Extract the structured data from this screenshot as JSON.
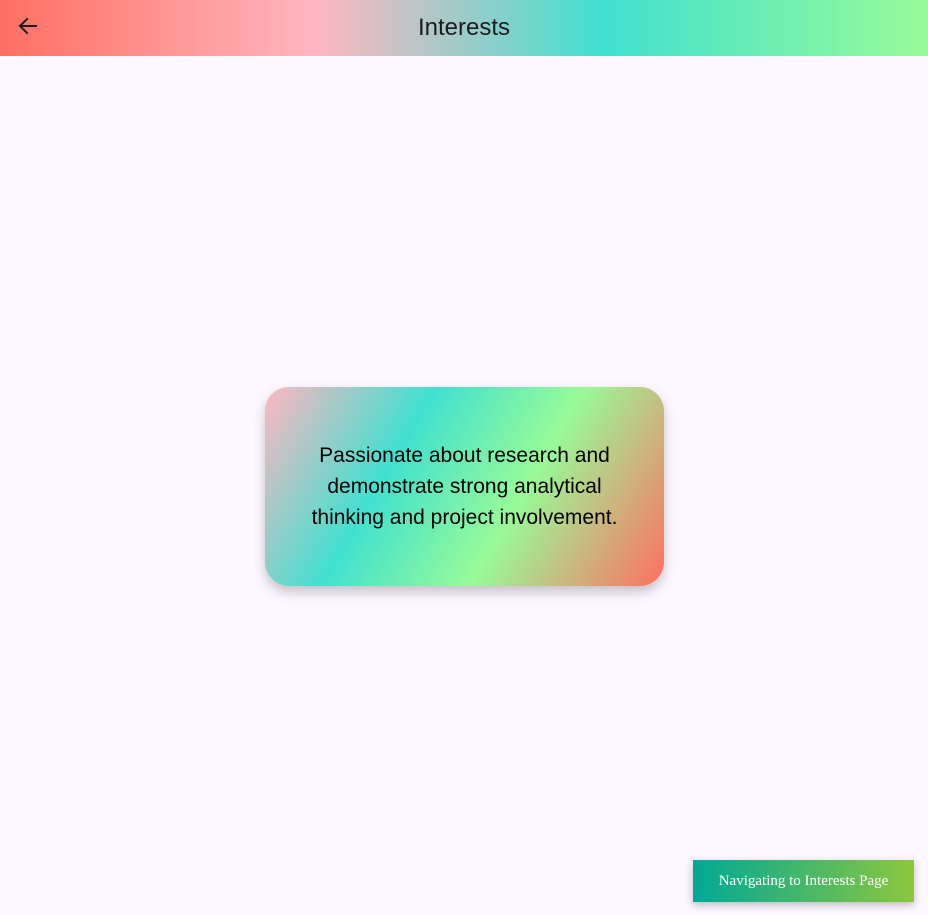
{
  "appbar": {
    "title": "Interests",
    "back_icon": "arrow-left-icon",
    "gradient_colors": [
      "#ff6f61",
      "#ffb6c1",
      "#40e0d0",
      "#98fb98"
    ]
  },
  "card": {
    "text": "Passionate about research and demonstrate strong analytical thinking and project involvement.",
    "gradient_colors": [
      "#ffb6c1",
      "#40e0d0",
      "#98fb98",
      "#ff6f61"
    ]
  },
  "snackbar": {
    "text": "Navigating to Interests Page",
    "gradient_colors": [
      "#00a896",
      "#8dc63f"
    ]
  },
  "background_color": "#fdf7ff"
}
